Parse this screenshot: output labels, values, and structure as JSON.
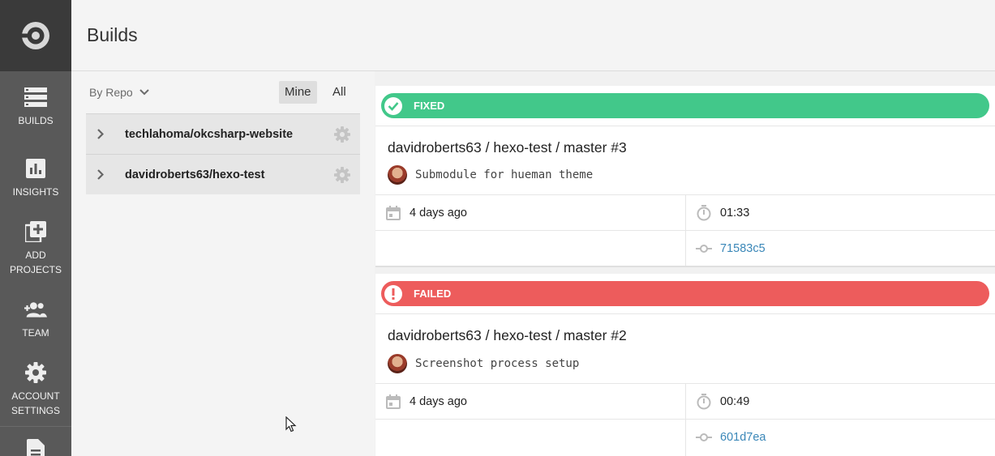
{
  "nav": {
    "logo": "circleci-logo-icon",
    "items": [
      {
        "label": "BUILDS",
        "icon": "builds-icon"
      },
      {
        "label": "INSIGHTS",
        "icon": "insights-icon"
      },
      {
        "label_line1": "ADD",
        "label_line2": "PROJECTS",
        "icon": "add-projects-icon"
      },
      {
        "label": "TEAM",
        "icon": "team-icon"
      },
      {
        "label_line1": "ACCOUNT",
        "label_line2": "SETTINGS",
        "icon": "settings-icon"
      },
      {
        "icon": "docs-icon"
      }
    ]
  },
  "header": {
    "title": "Builds"
  },
  "repos": {
    "filter_label": "By Repo",
    "toggle_mine": "Mine",
    "toggle_all": "All",
    "active_toggle": "Mine",
    "items": [
      {
        "name": "techlahoma/okcsharp-website"
      },
      {
        "name": "davidroberts63/hexo-test"
      }
    ]
  },
  "builds": [
    {
      "status": "FIXED",
      "status_color": "#42c88a",
      "title": "davidroberts63 / hexo-test / master #3",
      "commit_message": "Submodule for hueman theme",
      "time_ago": "4 days ago",
      "duration": "01:33",
      "sha": "71583c5"
    },
    {
      "status": "FAILED",
      "status_color": "#ed5c5c",
      "title": "davidroberts63 / hexo-test / master #2",
      "commit_message": "Screenshot process setup",
      "time_ago": "4 days ago",
      "duration": "00:49",
      "sha": "601d7ea"
    }
  ],
  "colors": {
    "sidebar": "#595959",
    "sidebar_dark": "#3a3a3a",
    "link": "#3a87b8"
  }
}
